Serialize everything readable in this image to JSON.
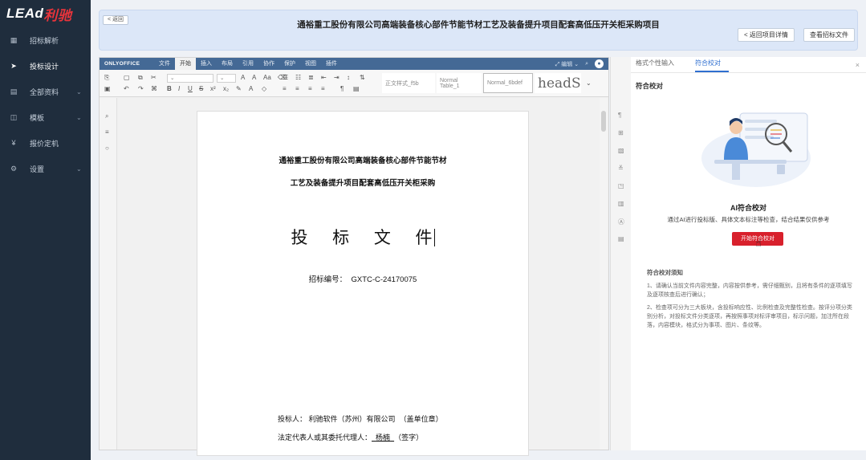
{
  "logo": {
    "text_left": "LEAd",
    "text_right": "利驰"
  },
  "sidebar": {
    "items": [
      {
        "label": "招标解析",
        "icon": "grid-icon",
        "glyph": "▦"
      },
      {
        "label": "投标设计",
        "icon": "send-icon",
        "glyph": "➤"
      },
      {
        "label": "全部资料",
        "icon": "folder-icon",
        "glyph": "▤",
        "chevron": "⌄"
      },
      {
        "label": "模板",
        "icon": "template-icon",
        "glyph": "◫",
        "chevron": "⌄"
      },
      {
        "label": "报价定机",
        "icon": "yen-icon",
        "glyph": "¥"
      },
      {
        "label": "设置",
        "icon": "gear-icon",
        "glyph": "⚙",
        "chevron": "⌄"
      }
    ],
    "active_index": 1
  },
  "header": {
    "back_label": "< 返回",
    "title": "通裕重工股份有限公司高端装备核心部件节能节材工艺及装备提升项目配套高低压开关柜采购项目",
    "buttons": [
      "< 返回项目详情",
      "查看招标文件"
    ]
  },
  "editor": {
    "brand": "ONLYOFFICE",
    "menu_tabs": [
      "文件",
      "开始",
      "插入",
      "布局",
      "引用",
      "协作",
      "保护",
      "视图",
      "插件"
    ],
    "active_tab": 1,
    "topbar_right": [
      "⤢ 编辑 ⌄",
      "⌕"
    ],
    "avatar_initial": "●",
    "style_boxes": [
      "正文样式_f5b",
      "Normal Table_1",
      "Normal_6bdef",
      "headS"
    ],
    "document": {
      "title_line1": "通裕重工股份有限公司高端装备核心部件节能节材",
      "title_line2": "工艺及装备提升项目配套高低压开关柜采购",
      "main_heading": "投 标 文 件",
      "bid_number_label": "招标编号：",
      "bid_number": "GXTC-C-24170075",
      "bidder_label": "投标人：",
      "bidder_value": "利驰软件（苏州）有限公司",
      "bidder_seal": "（盖单位章）",
      "rep_label": "法定代表人或其委托代理人：",
      "rep_name": "杨楠",
      "rep_sign": "（签字）"
    }
  },
  "panel": {
    "tabs": [
      "格式个性输入",
      "符合校对"
    ],
    "active_tab": 1,
    "heading": "符合校对",
    "ai_title": "AI符合校对",
    "ai_desc": "通过AI进行投标版、具体文本标注等检查，结合结果仅供参考",
    "start_button": "开始符合校对",
    "notes_title": "符合校对须知",
    "notes": [
      "1、请确认当前文件内容完整，内容按供参考，需仔细甄别，且将有条件的逐项填写及逐项核查后进行确认；",
      "2、检查项可分为三大板块，含投标响应性、比例检查及完整性检查。按评分项分类别分析，对投标文件分类逐项，再按照事项对标评审项目，标示问题，加注所在段落，内容模块，格式分为事项、图片、条纹等。"
    ]
  }
}
